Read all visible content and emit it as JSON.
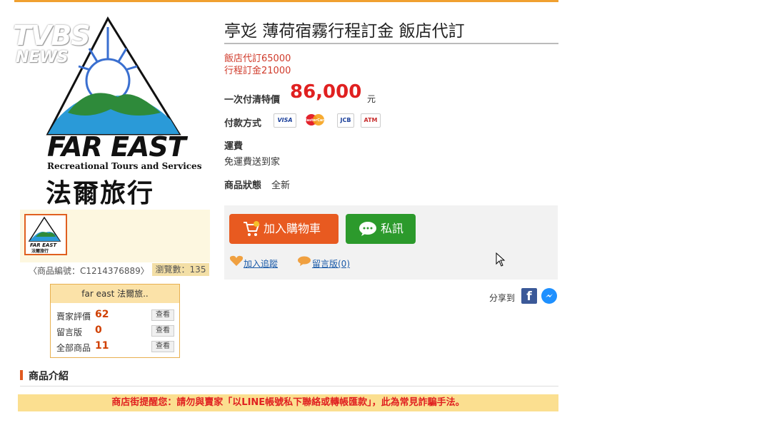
{
  "watermark": {
    "brand": "TVBS",
    "sub": "NEWS"
  },
  "logo": {
    "name_en": "FAR EAST",
    "tagline": "Recreational Tours and Services",
    "name_zh": "法爾旅行"
  },
  "thumbnail": {
    "text": "FAR EAST",
    "zh": "法爾旅行"
  },
  "product": {
    "id_label": "〈商品編號：C1214376889〉",
    "views_label": "瀏覽數：135",
    "title": "亭彣 薄荷宿霧行程訂金 飯店代訂",
    "line1": "飯店代訂65000",
    "line2": "行程訂金21000",
    "price_label": "一次付清特價",
    "price": "86,000",
    "price_unit": "元",
    "payment_label": "付款方式",
    "payment_methods": [
      "VISA",
      "MasterCard",
      "JCB",
      "ATM"
    ],
    "shipping_label": "運費",
    "shipping_value": "免運費送到家",
    "condition_label": "商品狀態",
    "condition_value": "全新"
  },
  "seller": {
    "name": "far east 法爾旅..",
    "rows": [
      {
        "label": "賣家評價",
        "value": "62",
        "action": "查看"
      },
      {
        "label": "留言版",
        "value": "0",
        "action": "查看"
      },
      {
        "label": "全部商品",
        "value": "11",
        "action": "查看"
      }
    ]
  },
  "actions": {
    "cart": "加入購物車",
    "message": "私訊",
    "track": "加入追蹤",
    "board": "留言版(0)",
    "share": "分享到"
  },
  "intro": {
    "heading": "商品介紹"
  },
  "warning": "商店街提醒您：請勿與賣家「以LINE帳號私下聯絡或轉帳匯款」，此為常見詐騙手法。",
  "colors": {
    "accent": "#e85a20",
    "green": "#2c9a2c",
    "price": "#e02020",
    "warning_bg": "#fbdf90"
  }
}
